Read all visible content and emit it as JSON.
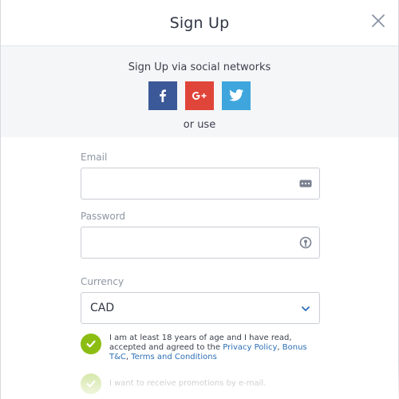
{
  "modal": {
    "title": "Sign Up",
    "close_icon": "close-icon"
  },
  "social": {
    "label": "Sign Up via social networks",
    "buttons": [
      {
        "name": "facebook",
        "icon": "facebook-icon",
        "color": "#3b5998"
      },
      {
        "name": "google-plus",
        "icon": "google-plus-icon",
        "color": "#e0453a"
      },
      {
        "name": "twitter",
        "icon": "twitter-icon",
        "color": "#3ea6dc"
      }
    ],
    "or_use": "or use"
  },
  "form": {
    "email": {
      "label": "Email",
      "value": "",
      "placeholder": "",
      "icon": "keyboard-icon"
    },
    "password": {
      "label": "Password",
      "value": "",
      "placeholder": "",
      "icon": "key-icon"
    },
    "currency": {
      "label": "Currency",
      "selected": "CAD",
      "icon": "chevron-down-icon"
    }
  },
  "agree": {
    "checked": true,
    "text_prefix": "I am at least 18 years of age and I have read, accepted and agreed to the ",
    "privacy_link": "Privacy Policy",
    "sep1": ", ",
    "bonus_link": "Bonus T&C",
    "sep2": ", ",
    "terms_link": "Terms and Conditions"
  },
  "promo": {
    "checked": true,
    "text": "I want to receive promotions by e-mail."
  },
  "colors": {
    "accent_green": "#8cbd12",
    "link_blue": "#2c6fb6",
    "facebook": "#3b5998",
    "google": "#e0453a",
    "twitter": "#3ea6dc"
  }
}
